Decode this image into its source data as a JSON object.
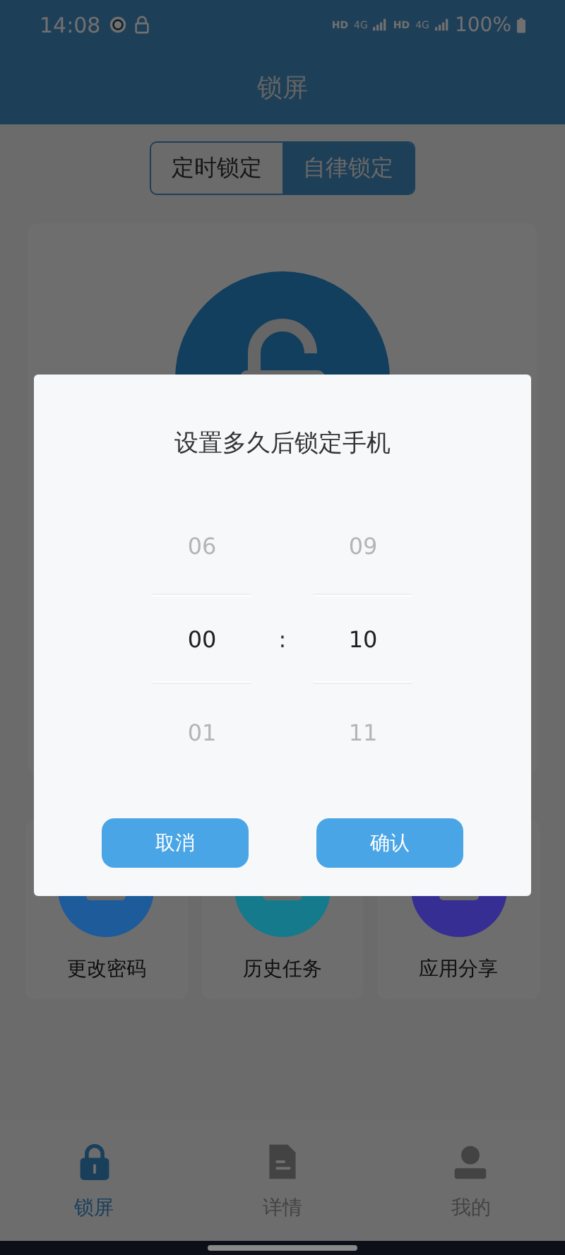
{
  "status_bar": {
    "time": "14:08",
    "network": [
      {
        "text": "HD",
        "kind": "label"
      },
      {
        "text": "4G",
        "kind": "signal"
      },
      {
        "text": "HD",
        "kind": "label"
      },
      {
        "text": "4G",
        "kind": "signal"
      }
    ],
    "battery": "100%"
  },
  "header": {
    "title": "锁屏"
  },
  "segments": [
    {
      "label": "定时锁定",
      "selected": false
    },
    {
      "label": "自律锁定",
      "selected": true
    }
  ],
  "features": [
    {
      "label": "更改密码",
      "color": "#1d5b9a"
    },
    {
      "label": "历史任务",
      "color": "#157a8c"
    },
    {
      "label": "应用分享",
      "color": "#362e92"
    }
  ],
  "dialog": {
    "title": "设置多久后锁定手机",
    "separator": ":",
    "columns": [
      {
        "items": [
          {
            "text": "06",
            "selected": false
          },
          {
            "text": "00",
            "selected": true
          },
          {
            "text": "01",
            "selected": false
          }
        ]
      },
      {
        "items": [
          {
            "text": "09",
            "selected": false
          },
          {
            "text": "10",
            "selected": true
          },
          {
            "text": "11",
            "selected": false
          }
        ]
      }
    ],
    "buttons": [
      "取消",
      "确认"
    ]
  },
  "nav": [
    {
      "label": "锁屏",
      "kind": "lock",
      "selected": true
    },
    {
      "label": "详情",
      "kind": "doc",
      "selected": false
    },
    {
      "label": "我的",
      "kind": "user",
      "selected": false
    }
  ]
}
